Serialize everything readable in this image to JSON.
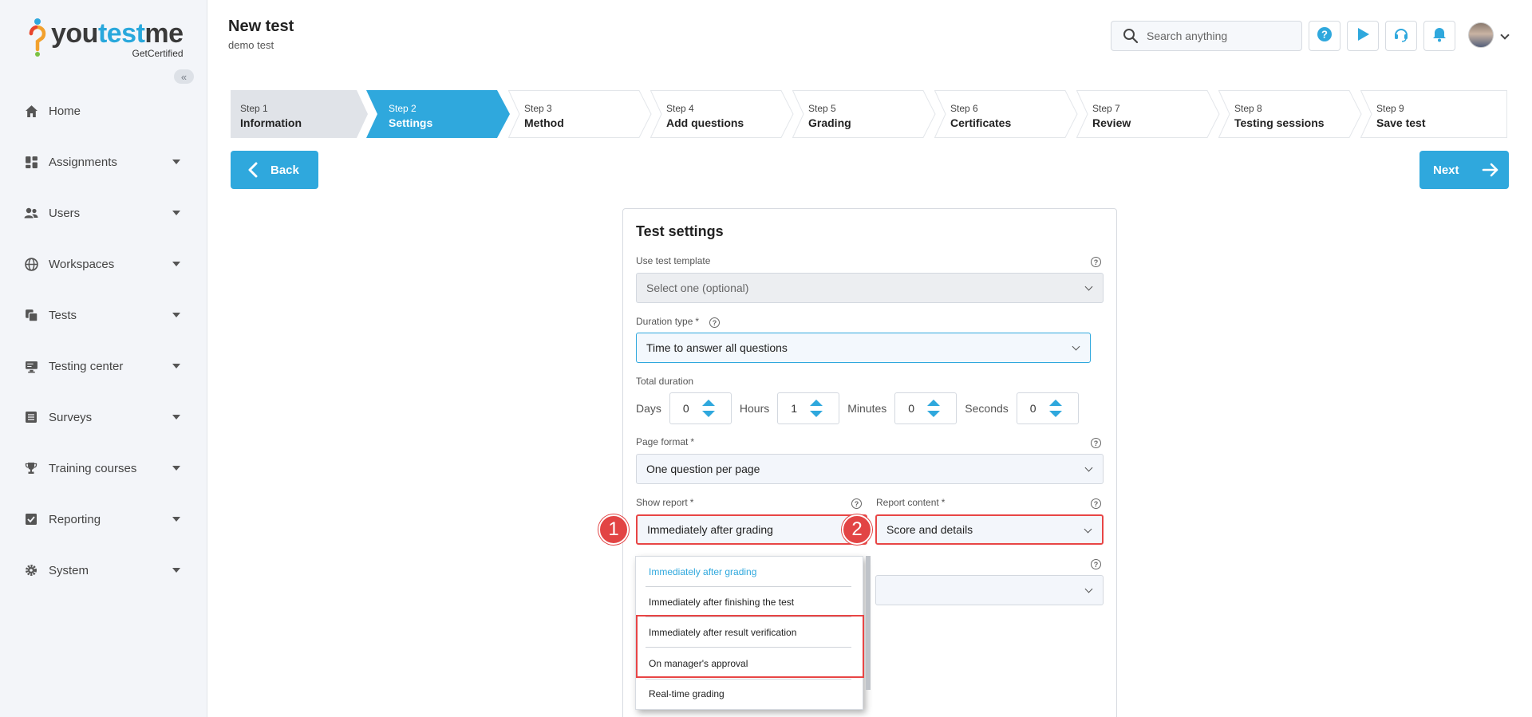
{
  "brand": {
    "logo_you": "you",
    "logo_test": "test",
    "logo_me": "me",
    "tagline": "GetCertified"
  },
  "sidebar": {
    "collapse_label": "«",
    "items": [
      {
        "label": "Home",
        "icon": "home-icon"
      },
      {
        "label": "Assignments",
        "icon": "dashboard-icon"
      },
      {
        "label": "Users",
        "icon": "users-icon"
      },
      {
        "label": "Workspaces",
        "icon": "globe-icon"
      },
      {
        "label": "Tests",
        "icon": "copy-icon"
      },
      {
        "label": "Testing center",
        "icon": "monitor-icon"
      },
      {
        "label": "Surveys",
        "icon": "list-icon"
      },
      {
        "label": "Training courses",
        "icon": "trophy-icon"
      },
      {
        "label": "Reporting",
        "icon": "check-square-icon"
      },
      {
        "label": "System",
        "icon": "gear-icon"
      }
    ]
  },
  "header": {
    "title": "New test",
    "subtitle": "demo test",
    "search_placeholder": "Search anything"
  },
  "steps": [
    {
      "num": "Step 1",
      "name": "Information",
      "state": "done"
    },
    {
      "num": "Step 2",
      "name": "Settings",
      "state": "active"
    },
    {
      "num": "Step 3",
      "name": "Method",
      "state": "todo"
    },
    {
      "num": "Step 4",
      "name": "Add questions",
      "state": "todo"
    },
    {
      "num": "Step 5",
      "name": "Grading",
      "state": "todo"
    },
    {
      "num": "Step 6",
      "name": "Certificates",
      "state": "todo"
    },
    {
      "num": "Step 7",
      "name": "Review",
      "state": "todo"
    },
    {
      "num": "Step 8",
      "name": "Testing sessions",
      "state": "todo"
    },
    {
      "num": "Step 9",
      "name": "Save test",
      "state": "todo"
    }
  ],
  "nav_buttons": {
    "back": "Back",
    "next": "Next"
  },
  "form": {
    "title": "Test settings",
    "template_label": "Use test template",
    "template_value": "Select one (optional)",
    "duration_type_label": "Duration type",
    "duration_type_value": "Time to answer all questions",
    "total_duration_label": "Total duration",
    "days_label": "Days",
    "days_value": "0",
    "hours_label": "Hours",
    "hours_value": "1",
    "minutes_label": "Minutes",
    "minutes_value": "0",
    "seconds_label": "Seconds",
    "seconds_value": "0",
    "page_format_label": "Page format",
    "page_format_value": "One question per page",
    "show_report_label": "Show report",
    "show_report_value": "Immediately after grading",
    "report_content_label": "Report content",
    "report_content_value": "Score and details",
    "required_mark": "*",
    "help_mark": "?"
  },
  "markers": {
    "one": "1",
    "two": "2"
  },
  "dropdown": {
    "options": [
      "Immediately after grading",
      "Immediately after finishing the test",
      "Immediately after result verification",
      "On manager's approval",
      "Real-time grading"
    ],
    "selected_index": 0
  },
  "colors": {
    "accent": "#2fa8dd",
    "highlight": "#e84545",
    "sidebar_bg": "#f3f5f9"
  }
}
